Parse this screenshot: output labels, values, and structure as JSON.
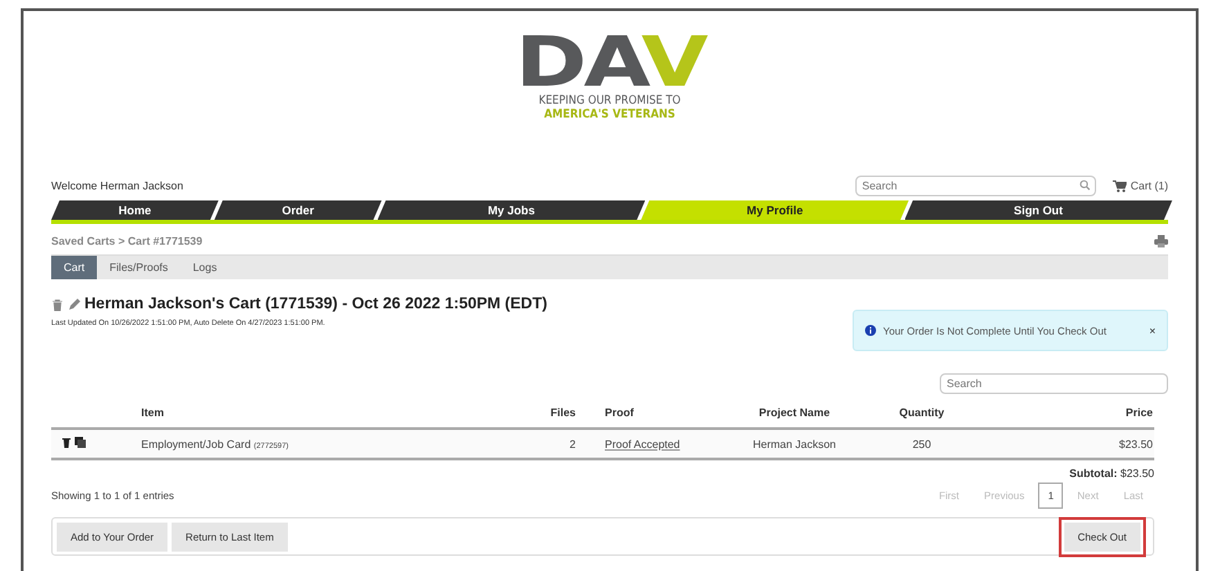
{
  "logo": {
    "mark": "DA",
    "mark_accent": "V",
    "tagline": [
      "KEEPING OUR PROMISE TO",
      "AMERICA'S VETERANS"
    ]
  },
  "header": {
    "welcome": "Welcome Herman Jackson",
    "search": {
      "placeholder": "Search"
    },
    "cart": "Cart (1)"
  },
  "nav": [
    {
      "label": "Home",
      "selected": false
    },
    {
      "label": "Order",
      "selected": false
    },
    {
      "label": "My Jobs",
      "selected": false
    },
    {
      "label": "My Profile",
      "selected": true
    },
    {
      "label": "Sign Out",
      "selected": false
    }
  ],
  "breadcrumb": "Saved Carts > Cart #1771539",
  "tabs": [
    {
      "label": "Cart",
      "selected": true
    },
    {
      "label": "Files/Proofs",
      "selected": false
    },
    {
      "label": "Logs",
      "selected": false
    }
  ],
  "cart_title": "Herman Jackson's Cart (1771539) - Oct 26 2022 1:50PM (EDT)",
  "last_updated": "Last Updated On 10/26/2022 1:51:00 PM, Auto Delete On 4/27/2023 1:51:00 PM.",
  "alert": {
    "message": "Your Order Is Not Complete Until You Check Out",
    "close": "×"
  },
  "table": {
    "search": {
      "placeholder": "Search"
    },
    "columns": [
      "Item",
      "Files",
      "Proof",
      "Project Name",
      "Quantity",
      "Price"
    ],
    "rows": [
      {
        "item": "Employment/Job Card",
        "item_id": "(2772597)",
        "files": "2",
        "proof": "Proof Accepted",
        "project_name": "Herman Jackson",
        "quantity": "250",
        "price": "$23.50"
      }
    ],
    "subtotal_label": "Subtotal:",
    "subtotal": "$23.50",
    "info": "Showing 1 to 1 of 1 entries",
    "pagination": [
      {
        "label": "First",
        "disabled": true,
        "selected": false
      },
      {
        "label": "Previous",
        "disabled": true,
        "selected": false
      },
      {
        "label": "1",
        "disabled": false,
        "selected": true
      },
      {
        "label": "Next",
        "disabled": true,
        "selected": false
      },
      {
        "label": "Last",
        "disabled": true,
        "selected": false
      }
    ]
  },
  "buttons": [
    {
      "label": "Add to Your Order",
      "highlighted": false
    },
    {
      "label": "Return to Last Item",
      "highlighted": false
    },
    {
      "label": "Check Out",
      "highlighted": true
    }
  ]
}
